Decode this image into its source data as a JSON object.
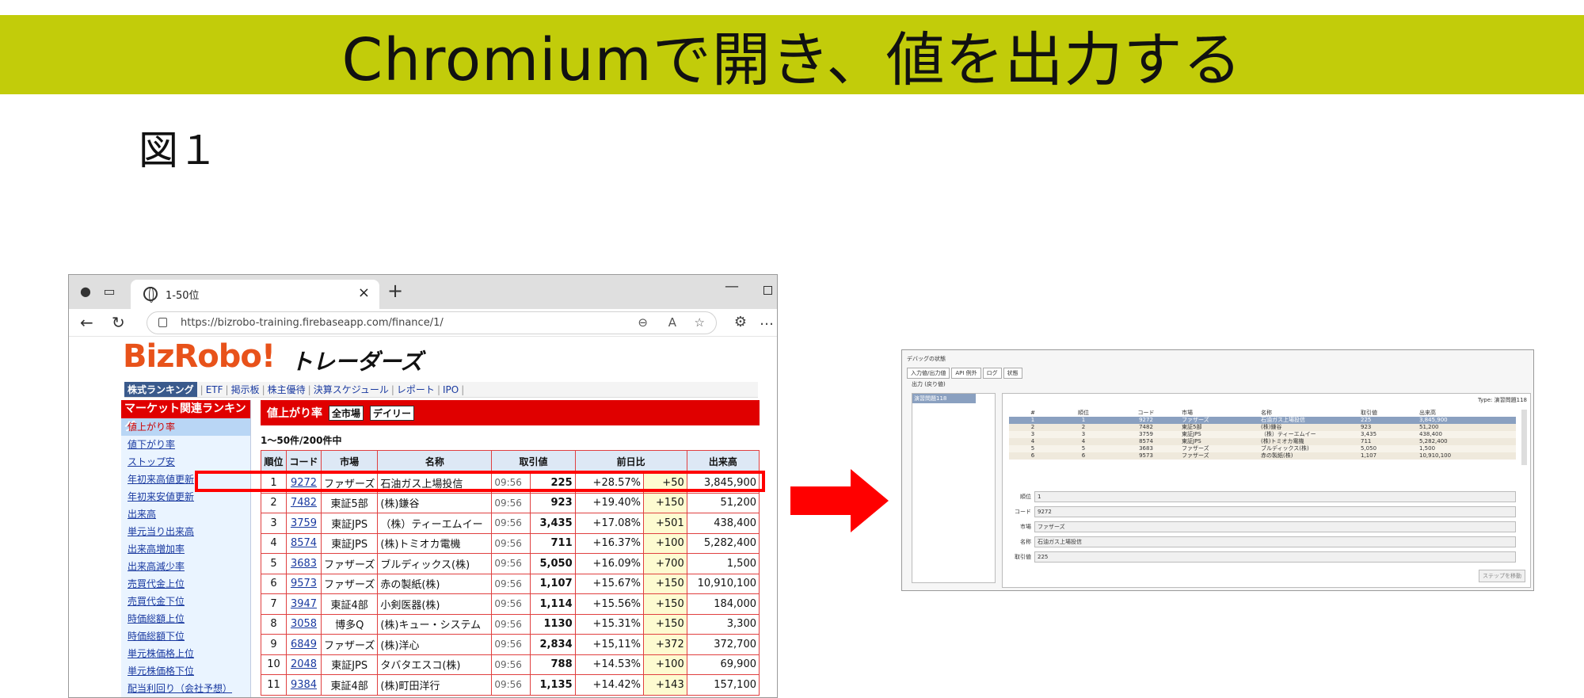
{
  "slide": {
    "title": "Chromiumで開き、値を出力する",
    "figure_label": "図１"
  },
  "browser": {
    "tab_title": "1-50位",
    "url": "https://bizrobo-training.firebaseapp.com/finance/1/",
    "logo": "BizRobo!",
    "logo_sub": "トレーダーズ",
    "topnav": {
      "active": "株式ランキング",
      "links": [
        "ETF",
        "掲示板",
        "株主優待",
        "決算スケジュール",
        "レポート",
        "IPO"
      ]
    },
    "sidebar": {
      "header": "マーケット関連ランキング",
      "items": [
        "値上がり率",
        "値下がり率",
        "ストップ安",
        "年初来高値更新",
        "年初来安値更新",
        "出来高",
        "単元当り出来高",
        "出来高増加率",
        "出来高減少率",
        "売買代金上位",
        "売買代金下位",
        "時価総額上位",
        "時価総額下位",
        "単元株価格上位",
        "単元株価格下位",
        "配当利回り（会社予想）"
      ]
    },
    "main": {
      "header": "値上がり率",
      "pill1": "全市場",
      "pill2": "デイリー",
      "count": "1～50件/200件中",
      "columns": [
        "順位",
        "コード",
        "市場",
        "名称",
        "取引値",
        "前日比",
        "出来高"
      ],
      "rows": [
        {
          "rank": "1",
          "code": "9272",
          "market": "ファザーズ",
          "name": "石油ガス上場投信",
          "time": "09:56",
          "price": "225",
          "pct": "+28.57%",
          "diff": "+50",
          "vol": "3,845,900"
        },
        {
          "rank": "2",
          "code": "7482",
          "market": "東証5部",
          "name": "(株)鎌谷",
          "time": "09:56",
          "price": "923",
          "pct": "+19.40%",
          "diff": "+150",
          "vol": "51,200"
        },
        {
          "rank": "3",
          "code": "3759",
          "market": "東証JPS",
          "name": "（株）ティーエムイー",
          "time": "09:56",
          "price": "3,435",
          "pct": "+17.08%",
          "diff": "+501",
          "vol": "438,400"
        },
        {
          "rank": "4",
          "code": "8574",
          "market": "東証JPS",
          "name": "(株)トミオカ電機",
          "time": "09:56",
          "price": "711",
          "pct": "+16.37%",
          "diff": "+100",
          "vol": "5,282,400"
        },
        {
          "rank": "5",
          "code": "3683",
          "market": "ファザーズ",
          "name": "ブルディックス(株)",
          "time": "09:56",
          "price": "5,050",
          "pct": "+16.09%",
          "diff": "+700",
          "vol": "1,500"
        },
        {
          "rank": "6",
          "code": "9573",
          "market": "ファザーズ",
          "name": "赤の製紙(株)",
          "time": "09:56",
          "price": "1,107",
          "pct": "+15.67%",
          "diff": "+150",
          "vol": "10,910,100"
        },
        {
          "rank": "7",
          "code": "3947",
          "market": "東証4部",
          "name": "小剣医器(株)",
          "time": "09:56",
          "price": "1,114",
          "pct": "+15.56%",
          "diff": "+150",
          "vol": "184,000"
        },
        {
          "rank": "8",
          "code": "3058",
          "market": "博多Q",
          "name": "(株)キュー・システム",
          "time": "09:56",
          "price": "1130",
          "pct": "+15.31%",
          "diff": "+150",
          "vol": "3,300"
        },
        {
          "rank": "9",
          "code": "6849",
          "market": "ファザーズ",
          "name": "(株)洋心",
          "time": "09:56",
          "price": "2,834",
          "pct": "+15,11%",
          "diff": "+372",
          "vol": "372,700"
        },
        {
          "rank": "10",
          "code": "2048",
          "market": "東証JPS",
          "name": "タバタエスコ(株)",
          "time": "09:56",
          "price": "788",
          "pct": "+14.53%",
          "diff": "+100",
          "vol": "69,900"
        },
        {
          "rank": "11",
          "code": "9384",
          "market": "東証4部",
          "name": "(株)町田洋行",
          "time": "09:56",
          "price": "1,135",
          "pct": "+14.42%",
          "diff": "+143",
          "vol": "157,100"
        }
      ]
    }
  },
  "debug": {
    "title": "デバッグの状態",
    "tabs": [
      "入力値/出力値",
      "API 例外",
      "ログ",
      "状態"
    ],
    "output_label": "出力 (戻り値)",
    "left_item": "演習問題118",
    "type_label": "Type: 演習問題118",
    "grid_columns": [
      "#",
      "順位",
      "コード",
      "市場",
      "名称",
      "取引値",
      "出来高"
    ],
    "grid_rows": [
      [
        "1",
        "1",
        "9272",
        "ファザーズ",
        "石油ガス上場投信",
        "225",
        "3,845,900"
      ],
      [
        "2",
        "2",
        "7482",
        "東証5部",
        "(株)鎌谷",
        "923",
        "51,200"
      ],
      [
        "3",
        "3",
        "3759",
        "東証JPS",
        "（株）ティーエムイー",
        "3,435",
        "438,400"
      ],
      [
        "4",
        "4",
        "8574",
        "東証JPS",
        "(株)トミオカ電機",
        "711",
        "5,282,400"
      ],
      [
        "5",
        "5",
        "3683",
        "ファザーズ",
        "ブルディックス(株)",
        "5,050",
        "1,500"
      ],
      [
        "6",
        "6",
        "9573",
        "ファザーズ",
        "赤の製紙(株)",
        "1,107",
        "10,910,100"
      ]
    ],
    "fields": [
      {
        "label": "順位",
        "value": "1"
      },
      {
        "label": "コード",
        "value": "9272"
      },
      {
        "label": "市場",
        "value": "ファザーズ"
      },
      {
        "label": "名称",
        "value": "石油ガス上場投信"
      },
      {
        "label": "取引値",
        "value": "225"
      }
    ],
    "step_button": "ステップを移動"
  },
  "colors": {
    "title_bar": "#c2cc0a",
    "arrow": "#ff0000",
    "highlight": "#ff0000",
    "logo": "#e8521a"
  }
}
